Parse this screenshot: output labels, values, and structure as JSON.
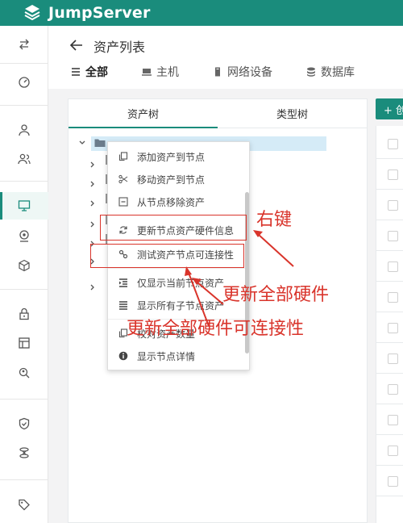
{
  "brand": {
    "name": "JumpServer",
    "header_color": "#1a8c7c",
    "accent": "#1a8c7c"
  },
  "rail": {
    "items": [
      {
        "icon": "swap-icon"
      },
      {
        "icon": "dashboard-icon"
      },
      {
        "icon": "user-icon"
      },
      {
        "icon": "user-group-icon"
      },
      {
        "icon": "monitor-icon",
        "active": true
      },
      {
        "icon": "location-icon"
      },
      {
        "icon": "cube-icon"
      },
      {
        "icon": "lock-icon"
      },
      {
        "icon": "layout-icon"
      },
      {
        "icon": "search-user-icon"
      },
      {
        "icon": "shield-icon"
      },
      {
        "icon": "network-icon"
      },
      {
        "icon": "tag-icon"
      }
    ]
  },
  "page": {
    "title": "资产列表",
    "tabs": [
      {
        "icon": "list-icon",
        "label": "全部",
        "active": true
      },
      {
        "icon": "host-icon",
        "label": "主机"
      },
      {
        "icon": "device-icon",
        "label": "网络设备"
      },
      {
        "icon": "database-icon",
        "label": "数据库"
      }
    ]
  },
  "tree_panel": {
    "tabs": [
      {
        "label": "资产树",
        "active": true
      },
      {
        "label": "类型树"
      }
    ]
  },
  "toolbar": {
    "create_label": "+ 创"
  },
  "context_menu": {
    "items": [
      {
        "icon": "copy-icon",
        "label": "添加资产到节点"
      },
      {
        "icon": "scissors-icon",
        "label": "移动资产到节点"
      },
      {
        "icon": "minus-square-icon",
        "label": "从节点移除资产"
      },
      {
        "icon": "refresh-icon",
        "label": "更新节点资产硬件信息"
      },
      {
        "icon": "link-icon",
        "label": "测试资产节点可连接性"
      },
      {
        "icon": "indent-icon",
        "label": "仅显示当前节点资产"
      },
      {
        "icon": "list-all-icon",
        "label": "显示所有子节点资产"
      },
      {
        "icon": "copy-icon",
        "label": "校对资产数量"
      },
      {
        "icon": "info-icon",
        "label": "显示节点详情"
      }
    ]
  },
  "annotations": {
    "right_click": "右键",
    "update_hw": "更新全部硬件",
    "update_conn": "更新全部硬件可连接性",
    "color": "#d9342b"
  }
}
